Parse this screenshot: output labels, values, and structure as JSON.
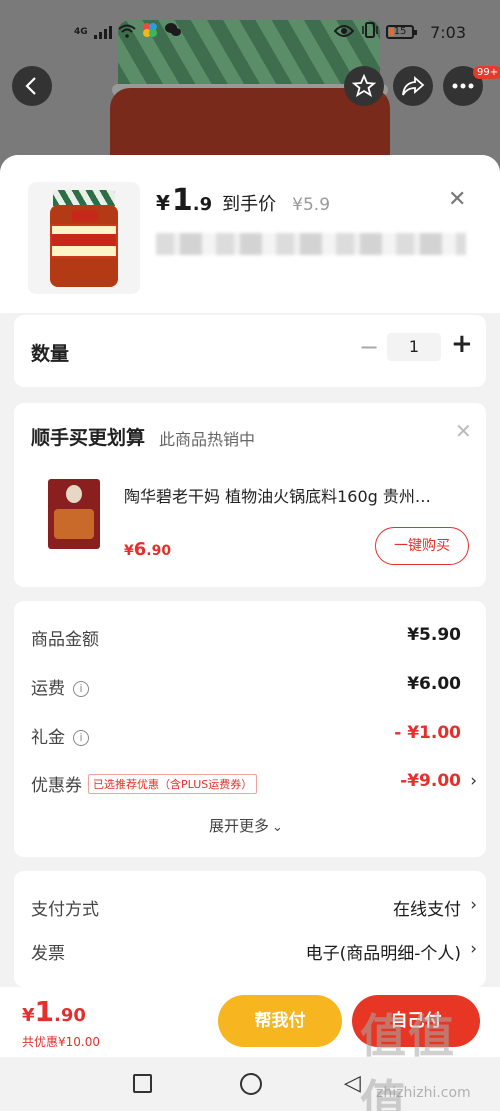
{
  "status_bar": {
    "network": "4G",
    "battery": "15",
    "time": "7:03"
  },
  "top_nav": {
    "badge": "99+"
  },
  "product": {
    "yen": "¥",
    "price_int": "1",
    "price_dec": ".9",
    "price_label": "到手价",
    "original_price": "¥5.9"
  },
  "quantity": {
    "label": "数量",
    "minus": "−",
    "value": "1",
    "plus": "+"
  },
  "addon": {
    "title": "顺手买更划算",
    "subtitle": "此商品热销中",
    "item_name": "陶华碧老干妈 植物油火锅底料160g 贵州…",
    "price_yen": "¥",
    "price_int": "6",
    "price_dec": ".90",
    "buy_label": "一键购买"
  },
  "summary": {
    "goods_label": "商品金额",
    "goods_value": "¥5.90",
    "shipping_label": "运费",
    "shipping_value": "¥6.00",
    "gift_label": "礼金",
    "gift_value": "- ¥1.00",
    "coupon_label": "优惠券",
    "coupon_tag": "已选推荐优惠（含PLUS运费券）",
    "coupon_value": "-¥9.00",
    "expand_label": "展开更多"
  },
  "payment": {
    "method_label": "支付方式",
    "method_value": "在线支付",
    "invoice_label": "发票",
    "invoice_value": "电子(商品明细-个人)"
  },
  "bottom": {
    "total_yen": "¥",
    "total_int": "1",
    "total_dec": ".90",
    "saved": "共优惠¥10.00",
    "help_pay": "帮我付",
    "self_pay": "自己付"
  },
  "watermark": {
    "main": "值值值",
    "sub": "zhizhizhi.com"
  },
  "colors": {
    "accent": "#e4302c",
    "help_button": "#f7b51f",
    "pay_button": "#e83624"
  }
}
